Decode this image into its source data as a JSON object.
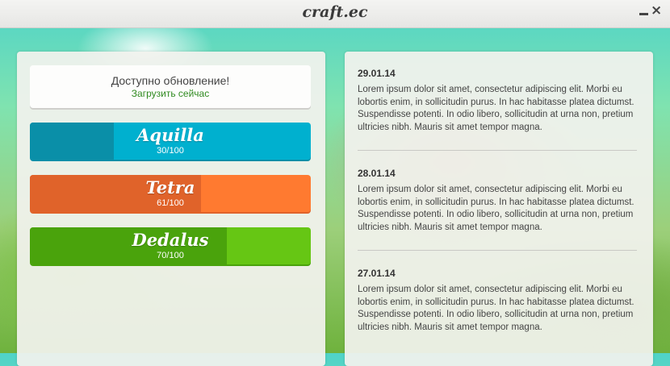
{
  "window": {
    "title": "craft.ec",
    "minimize_icon": "minimize-icon",
    "close_icon": "close-icon",
    "close_glyph": "×"
  },
  "update": {
    "title": "Доступно обновление!",
    "link": "Загрузить сейчас",
    "link_color": "#2f8a1f"
  },
  "servers": [
    {
      "name": "Aquilla",
      "online": 30,
      "max": 100,
      "count_label": "30/100",
      "color": "#00b0cf",
      "fill_color": "#0a8fa8"
    },
    {
      "name": "Tetra",
      "online": 61,
      "max": 100,
      "count_label": "61/100",
      "color": "#ff7a30",
      "fill_color": "#e0632a"
    },
    {
      "name": "Dedalus",
      "online": 70,
      "max": 100,
      "count_label": "70/100",
      "color": "#66c614",
      "fill_color": "#4aa30c"
    }
  ],
  "news": [
    {
      "date": "29.01.14",
      "text": "Lorem ipsum dolor sit amet, consectetur adipiscing elit. Morbi eu lobortis enim, in sollicitudin purus. In hac habitasse platea dictumst. Suspendisse potenti. In odio libero, sollicitudin at urna non, pretium ultricies nibh. Mauris sit amet tempor magna."
    },
    {
      "date": "28.01.14",
      "text": "Lorem ipsum dolor sit amet, consectetur adipiscing elit. Morbi eu lobortis enim, in sollicitudin purus. In hac habitasse platea dictumst. Suspendisse potenti. In odio libero, sollicitudin at urna non, pretium ultricies nibh. Mauris sit amet tempor magna."
    },
    {
      "date": "27.01.14",
      "text": "Lorem ipsum dolor sit amet, consectetur adipiscing elit. Morbi eu lobortis enim, in sollicitudin purus. In hac habitasse platea dictumst. Suspendisse potenti. In odio libero, sollicitudin at urna non, pretium ultricies nibh. Mauris sit amet tempor magna."
    }
  ]
}
